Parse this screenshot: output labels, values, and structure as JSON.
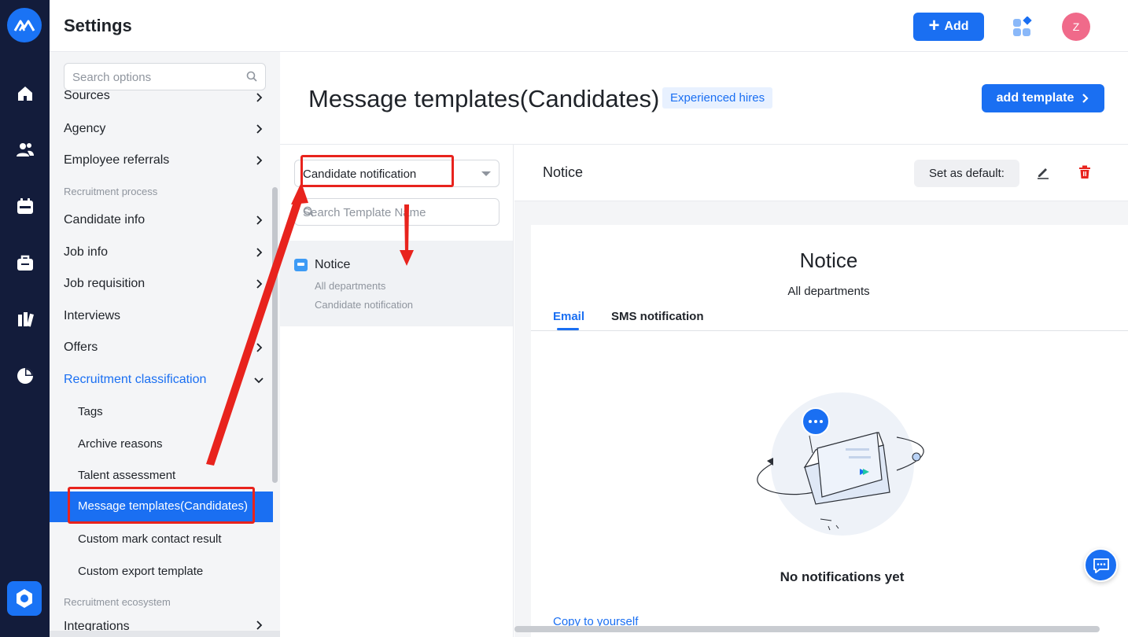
{
  "app": {
    "title": "Settings"
  },
  "header": {
    "add_label": "Add",
    "avatar_initial": "Z"
  },
  "sidebar": {
    "search_placeholder": "Search options",
    "items": [
      {
        "label": "Sources"
      },
      {
        "label": "Agency"
      },
      {
        "label": "Employee referrals"
      }
    ],
    "group_recruitment_process": "Recruitment process",
    "process_items": [
      {
        "label": "Candidate info"
      },
      {
        "label": "Job info"
      },
      {
        "label": "Job requisition"
      },
      {
        "label": "Interviews"
      },
      {
        "label": "Offers"
      },
      {
        "label": "Recruitment classification"
      }
    ],
    "sub_items": [
      {
        "label": "Tags"
      },
      {
        "label": "Archive reasons"
      },
      {
        "label": "Talent assessment"
      },
      {
        "label": "Message templates(Candidates)"
      },
      {
        "label": "Custom mark contact result"
      },
      {
        "label": "Custom export template"
      }
    ],
    "group_ecosystem": "Recruitment ecosystem",
    "ecosystem_items": [
      {
        "label": "Integrations"
      }
    ]
  },
  "main": {
    "page_title": "Message templates(Candidates)",
    "tag": "Experienced hires",
    "add_template_label": "add template"
  },
  "list": {
    "select_value": "Candidate notification",
    "search_placeholder": "Search Template Name",
    "templates": [
      {
        "name": "Notice",
        "department": "All departments",
        "type": "Candidate notification"
      }
    ]
  },
  "detail": {
    "title": "Notice",
    "set_default_label": "Set as default:",
    "card_title": "Notice",
    "card_department": "All departments",
    "tabs": [
      {
        "label": "Email"
      },
      {
        "label": "SMS notification"
      }
    ],
    "empty_text": "No notifications yet",
    "copy_link": "Copy to yourself"
  },
  "colors": {
    "primary": "#1a6ff2",
    "rail": "#131c3b",
    "annotation": "#e8231d"
  }
}
